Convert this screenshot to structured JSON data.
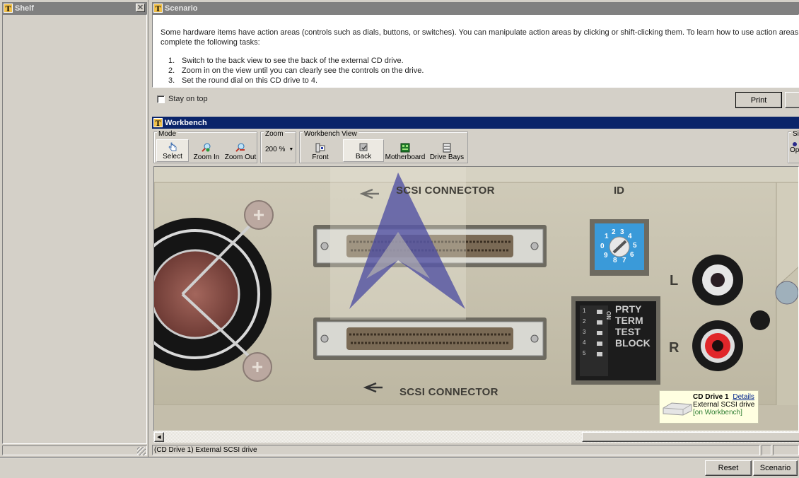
{
  "shelf": {
    "title": "Shelf",
    "close_icon": "close-icon"
  },
  "scenario": {
    "title": "Scenario",
    "intro": "Some hardware items have action areas (controls such as dials, buttons, or switches). You can manipulate action areas by clicking or shift-clicking them. To learn how to use action areas, complete the following tasks:",
    "tasks": [
      {
        "num": "1.",
        "text": "Switch to the back view to see the back of the external CD drive."
      },
      {
        "num": "2.",
        "text": "Zoom in on the view until you can clearly see the controls on the drive."
      },
      {
        "num": "3.",
        "text": "Set the round dial on this CD drive to 4."
      }
    ],
    "stay_on_top_label": "Stay on top",
    "stay_on_top_checked": false,
    "print_label": "Print"
  },
  "workbench": {
    "title": "Workbench",
    "mode_group": "Mode",
    "mode_tools": [
      {
        "label": "Select",
        "icon": "hand-pointer-icon",
        "pressed": true
      },
      {
        "label": "Zoom In",
        "icon": "zoom-in-icon",
        "pressed": false
      },
      {
        "label": "Zoom Out",
        "icon": "zoom-out-icon",
        "pressed": false
      }
    ],
    "zoom_group": "Zoom",
    "zoom_value": "200 %",
    "view_group": "Workbench View",
    "view_tools": [
      {
        "label": "Front",
        "icon": "front-view-icon",
        "pressed": false
      },
      {
        "label": "Back",
        "icon": "back-view-icon",
        "pressed": true
      },
      {
        "label": "Motherboard",
        "icon": "motherboard-icon",
        "pressed": false
      },
      {
        "label": "Drive Bays",
        "icon": "drive-bays-icon",
        "pressed": false
      }
    ],
    "sim_group": "Sim",
    "sim_option": "Op",
    "device": {
      "scsi_top": "SCSI CONNECTOR",
      "scsi_bottom": "SCSI CONNECTOR",
      "id_label": "ID",
      "dial_numbers": [
        "0",
        "1",
        "2",
        "3",
        "4",
        "5",
        "6",
        "7",
        "8",
        "9"
      ],
      "left_label": "L",
      "right_label": "R",
      "dip_on_label": "ON",
      "dip_labels": [
        "PRTY",
        "TERM",
        "TEST",
        "BLOCK"
      ],
      "dip_numbers": [
        "1",
        "2",
        "3",
        "4",
        "5"
      ]
    },
    "tooltip": {
      "name": "CD Drive 1",
      "details_link": "Details",
      "description": "External SCSI drive",
      "location": "[on Workbench]"
    },
    "status_text": "(CD Drive 1) External SCSI drive"
  },
  "footer": {
    "reset_label": "Reset",
    "scenario_label": "Scenario"
  },
  "colors": {
    "active_title": "#0a246a",
    "inactive_title": "#808080",
    "window_bg": "#d4d0c8",
    "dial_blue": "#3a9ad9",
    "tooltip_bg": "#ffffe1",
    "tooltip_location": "#2e7d32"
  }
}
